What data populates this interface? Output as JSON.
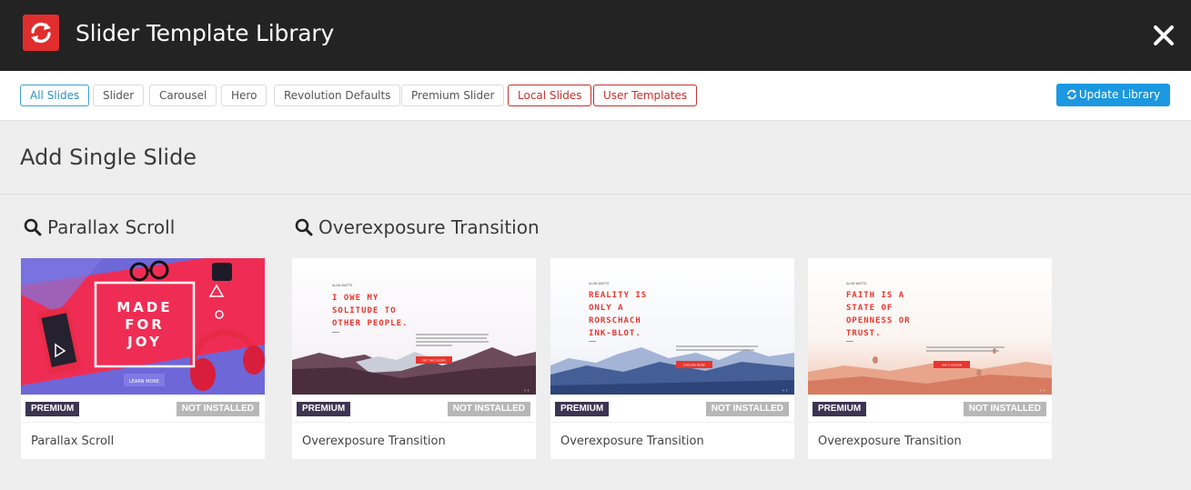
{
  "header": {
    "title": "Slider Template Library",
    "logo_icon": "revolution-refresh-icon",
    "close_icon": "close-icon",
    "background": "#232323",
    "logo_color": "#e12d2d"
  },
  "toolbar": {
    "filters": [
      {
        "label": "All Slides",
        "state": "active"
      },
      {
        "label": "Slider",
        "state": "default"
      },
      {
        "label": "Carousel",
        "state": "default"
      },
      {
        "label": "Hero",
        "state": "default"
      },
      {
        "label": "Revolution Defaults",
        "state": "default"
      },
      {
        "label": "Premium Slider",
        "state": "default"
      },
      {
        "label": "Local Slides",
        "state": "red"
      },
      {
        "label": "User Templates",
        "state": "red"
      }
    ],
    "update_label": "Update Library",
    "update_icon": "refresh-icon",
    "accent": "#1b98e0"
  },
  "main": {
    "section_title": "Add Single Slide",
    "groups": [
      {
        "title": "Parallax Scroll",
        "icon": "search-icon",
        "cards": [
          {
            "name": "Parallax Scroll",
            "premium_badge": "PREMIUM",
            "status_badge": "NOT INSTALLED",
            "thumb": {
              "headline": "MADE\nFOR\nJOY",
              "button": "LEARN MORE"
            }
          }
        ]
      },
      {
        "title": "Overexposure Transition",
        "icon": "search-icon",
        "cards": [
          {
            "name": "Overexposure Transition",
            "premium_badge": "PREMIUM",
            "status_badge": "NOT INSTALLED",
            "thumb": {
              "author": "ALAN WATTS",
              "headline": "I OWE MY\nSOLITUDE TO\nOTHER PEOPLE.",
              "button": "GET THIS SLIDER"
            }
          },
          {
            "name": "Overexposure Transition",
            "premium_badge": "PREMIUM",
            "status_badge": "NOT INSTALLED",
            "thumb": {
              "author": "ALAN WATTS",
              "headline": "REALITY IS\nONLY A\nRORSCHACH\nINK-BLOT.",
              "button": "EXPLORE MORE"
            }
          },
          {
            "name": "Overexposure Transition",
            "premium_badge": "PREMIUM",
            "status_badge": "NOT INSTALLED",
            "thumb": {
              "author": "ALAN WATTS",
              "headline": "FAITH IS A\nSTATE OF\nOPENNESS OR\nTRUST.",
              "button": "ASK A LESSON"
            }
          }
        ]
      }
    ]
  },
  "colors": {
    "premium_badge": "#3b3552",
    "not_installed_badge": "#b7b7b7",
    "slide_red": "#e8372f"
  }
}
